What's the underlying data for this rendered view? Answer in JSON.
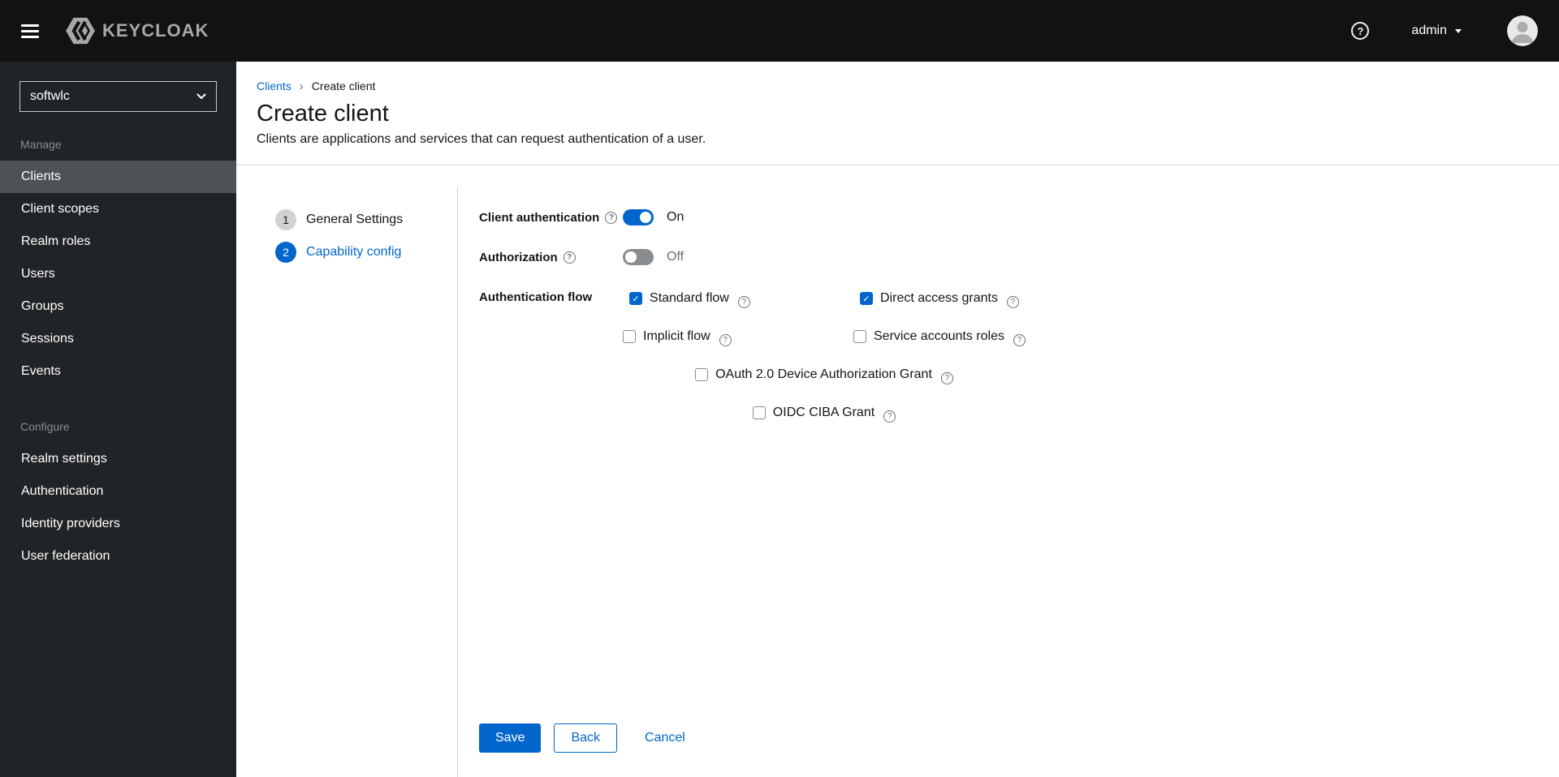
{
  "glyphs": {
    "help": "?",
    "breadcrumb_separator": "›",
    "check": "✓"
  },
  "header": {
    "brand": "KEYCLOAK",
    "user": "admin"
  },
  "sidebar": {
    "realm": "softwlc",
    "sections": [
      {
        "label": "Manage",
        "items": [
          {
            "label": "Clients",
            "active": true
          },
          {
            "label": "Client scopes",
            "active": false
          },
          {
            "label": "Realm roles",
            "active": false
          },
          {
            "label": "Users",
            "active": false
          },
          {
            "label": "Groups",
            "active": false
          },
          {
            "label": "Sessions",
            "active": false
          },
          {
            "label": "Events",
            "active": false
          }
        ]
      },
      {
        "label": "Configure",
        "items": [
          {
            "label": "Realm settings",
            "active": false
          },
          {
            "label": "Authentication",
            "active": false
          },
          {
            "label": "Identity providers",
            "active": false
          },
          {
            "label": "User federation",
            "active": false
          }
        ]
      }
    ]
  },
  "breadcrumb": {
    "items": [
      "Clients",
      "Create client"
    ]
  },
  "page": {
    "title": "Create client",
    "subtitle": "Clients are applications and services that can request authentication of a user."
  },
  "wizard": {
    "steps": [
      {
        "number": "1",
        "label": "General Settings",
        "active": false
      },
      {
        "number": "2",
        "label": "Capability config",
        "active": true
      }
    ]
  },
  "form": {
    "client_auth": {
      "label": "Client authentication",
      "state": "On",
      "enabled": true
    },
    "authorization": {
      "label": "Authorization",
      "state": "Off",
      "enabled": false
    },
    "auth_flow": {
      "label": "Authentication flow",
      "options": [
        {
          "label": "Standard flow",
          "checked": true
        },
        {
          "label": "Direct access grants",
          "checked": true
        },
        {
          "label": "Implicit flow",
          "checked": false
        },
        {
          "label": "Service accounts roles",
          "checked": false
        },
        {
          "label": "OAuth 2.0 Device Authorization Grant",
          "checked": false
        },
        {
          "label": "OIDC CIBA Grant",
          "checked": false
        }
      ]
    }
  },
  "actions": {
    "save": "Save",
    "back": "Back",
    "cancel": "Cancel"
  },
  "colors": {
    "accent": "#0066cc",
    "masthead_bg": "#121212",
    "sidebar_bg": "#212427",
    "sidebar_active_bg": "#4f5255",
    "divider": "#d2d2d2",
    "toggle_off": "#8a8d90"
  }
}
